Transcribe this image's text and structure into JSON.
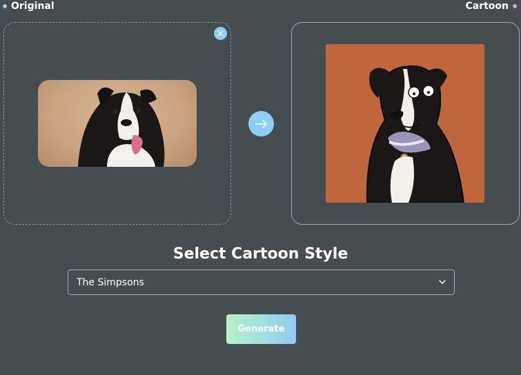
{
  "labels": {
    "original": "Original",
    "cartoon": "Cartoon"
  },
  "colors": {
    "accent_blue": "#8ecdf4",
    "accent_pink": "#c9a2e3",
    "cartoon_bg": "#c0663c",
    "background": "#454d51"
  },
  "icons": {
    "close": "close-icon",
    "arrow": "arrow-right-icon",
    "dropdown": "chevron-down-icon"
  },
  "section": {
    "title": "Select Cartoon Style"
  },
  "style_select": {
    "selected": "The Simpsons"
  },
  "actions": {
    "generate_label": "Generate"
  }
}
